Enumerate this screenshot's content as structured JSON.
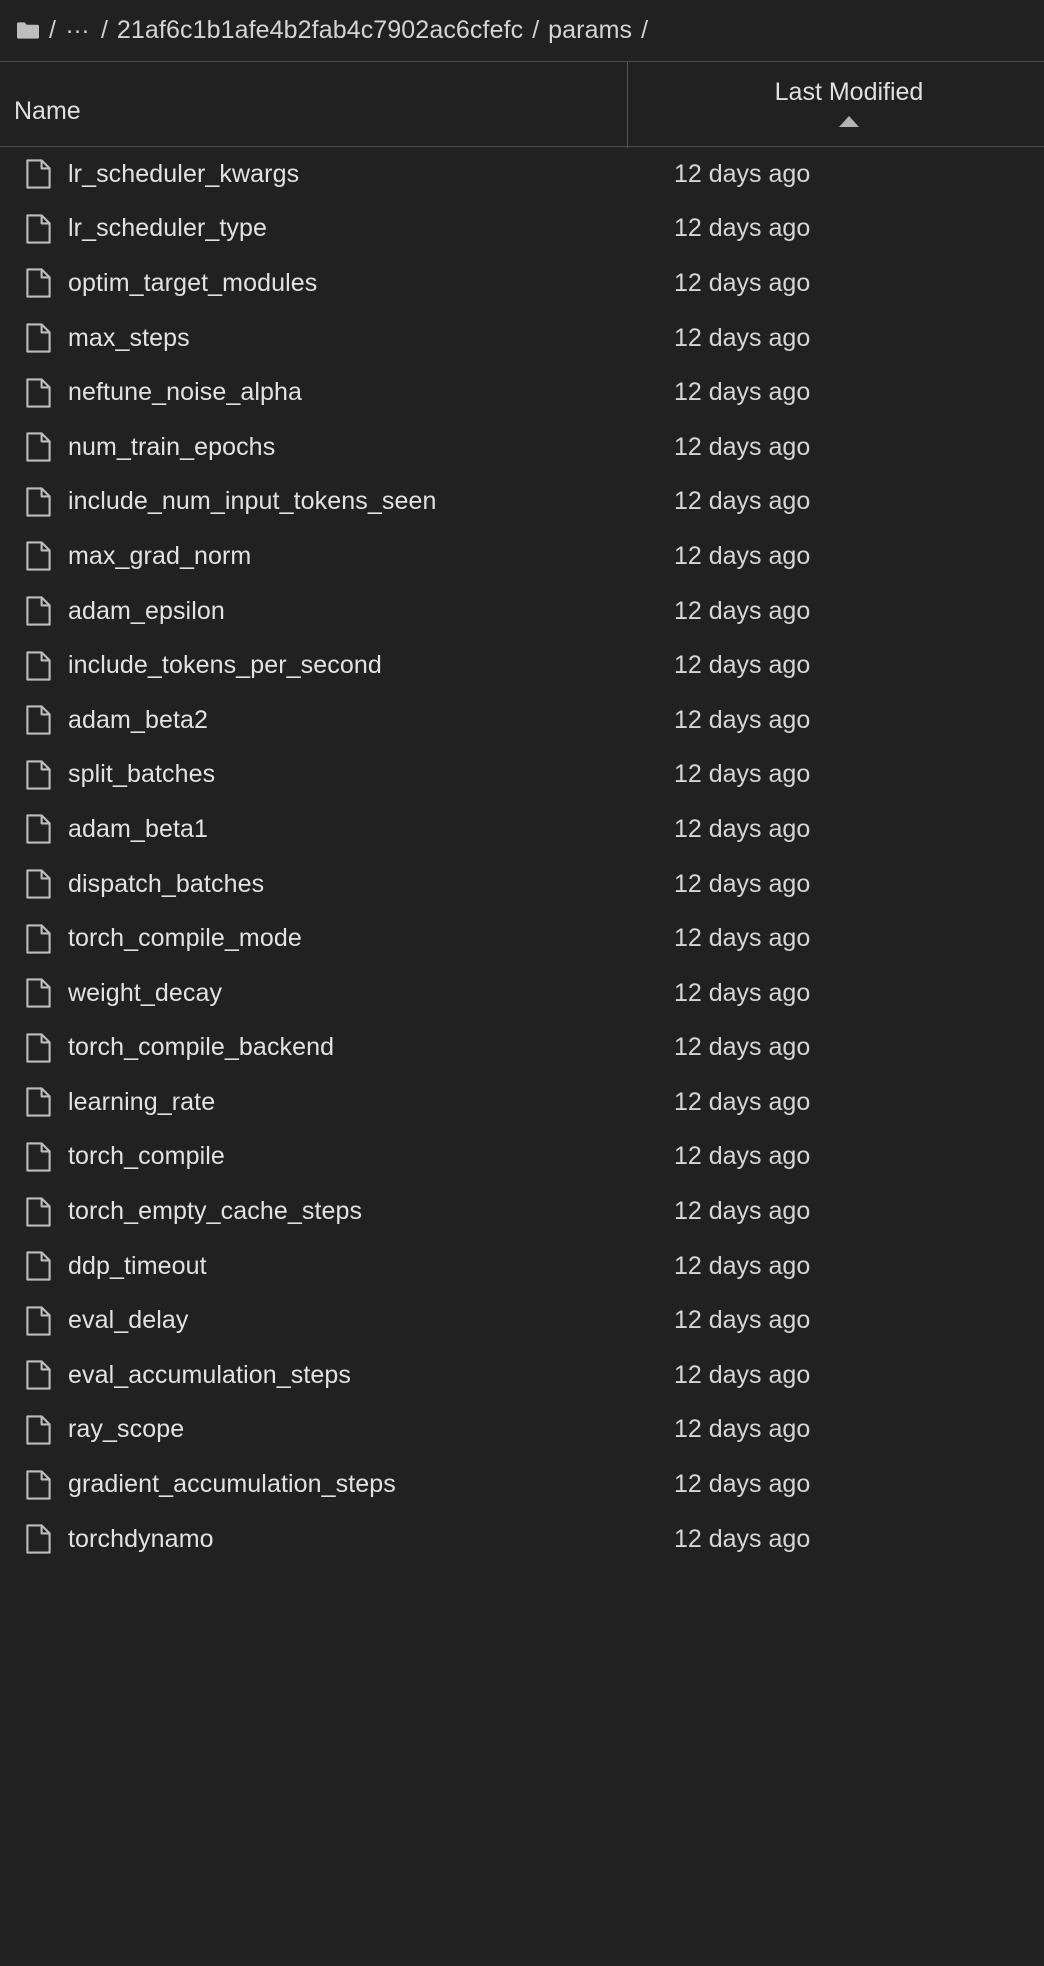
{
  "breadcrumb": {
    "home_icon": "folder-icon",
    "separator": "/",
    "ellipsis": "…",
    "segments": [
      {
        "label": "21af6c1b1afe4b2fab4c7902ac6cfefc"
      },
      {
        "label": "params"
      }
    ]
  },
  "colors": {
    "background": "#212121",
    "text": "#e2e2e2",
    "muted_text": "#d6d6d6",
    "divider": "#4a4a4a",
    "icon_outline": "#bdbdbd",
    "sort_arrow": "#b3b3b3"
  },
  "table": {
    "columns": [
      {
        "key": "name",
        "label": "Name",
        "sorted": false
      },
      {
        "key": "last_modified",
        "label": "Last Modified",
        "sorted": true,
        "sort_direction": "ascending"
      }
    ],
    "rows": [
      {
        "icon": "file-icon",
        "name": "lr_scheduler_kwargs",
        "last_modified": "12 days ago"
      },
      {
        "icon": "file-icon",
        "name": "lr_scheduler_type",
        "last_modified": "12 days ago"
      },
      {
        "icon": "file-icon",
        "name": "optim_target_modules",
        "last_modified": "12 days ago"
      },
      {
        "icon": "file-icon",
        "name": "max_steps",
        "last_modified": "12 days ago"
      },
      {
        "icon": "file-icon",
        "name": "neftune_noise_alpha",
        "last_modified": "12 days ago"
      },
      {
        "icon": "file-icon",
        "name": "num_train_epochs",
        "last_modified": "12 days ago"
      },
      {
        "icon": "file-icon",
        "name": "include_num_input_tokens_seen",
        "last_modified": "12 days ago"
      },
      {
        "icon": "file-icon",
        "name": "max_grad_norm",
        "last_modified": "12 days ago"
      },
      {
        "icon": "file-icon",
        "name": "adam_epsilon",
        "last_modified": "12 days ago"
      },
      {
        "icon": "file-icon",
        "name": "include_tokens_per_second",
        "last_modified": "12 days ago"
      },
      {
        "icon": "file-icon",
        "name": "adam_beta2",
        "last_modified": "12 days ago"
      },
      {
        "icon": "file-icon",
        "name": "split_batches",
        "last_modified": "12 days ago"
      },
      {
        "icon": "file-icon",
        "name": "adam_beta1",
        "last_modified": "12 days ago"
      },
      {
        "icon": "file-icon",
        "name": "dispatch_batches",
        "last_modified": "12 days ago"
      },
      {
        "icon": "file-icon",
        "name": "torch_compile_mode",
        "last_modified": "12 days ago"
      },
      {
        "icon": "file-icon",
        "name": "weight_decay",
        "last_modified": "12 days ago"
      },
      {
        "icon": "file-icon",
        "name": "torch_compile_backend",
        "last_modified": "12 days ago"
      },
      {
        "icon": "file-icon",
        "name": "learning_rate",
        "last_modified": "12 days ago"
      },
      {
        "icon": "file-icon",
        "name": "torch_compile",
        "last_modified": "12 days ago"
      },
      {
        "icon": "file-icon",
        "name": "torch_empty_cache_steps",
        "last_modified": "12 days ago"
      },
      {
        "icon": "file-icon",
        "name": "ddp_timeout",
        "last_modified": "12 days ago"
      },
      {
        "icon": "file-icon",
        "name": "eval_delay",
        "last_modified": "12 days ago"
      },
      {
        "icon": "file-icon",
        "name": "eval_accumulation_steps",
        "last_modified": "12 days ago"
      },
      {
        "icon": "file-icon",
        "name": "ray_scope",
        "last_modified": "12 days ago"
      },
      {
        "icon": "file-icon",
        "name": "gradient_accumulation_steps",
        "last_modified": "12 days ago"
      },
      {
        "icon": "file-icon",
        "name": "torchdynamo",
        "last_modified": "12 days ago"
      }
    ]
  }
}
